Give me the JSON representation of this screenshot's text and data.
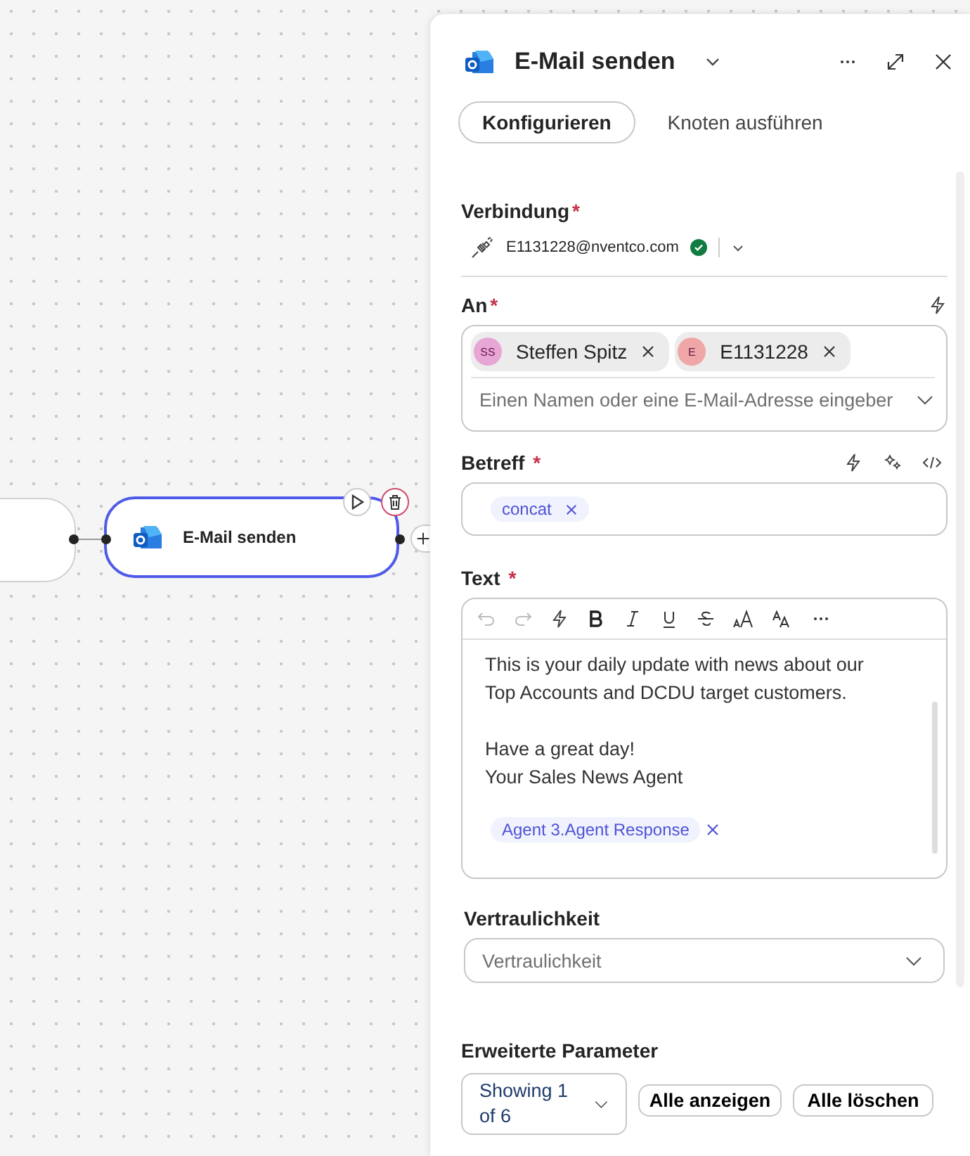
{
  "canvas": {
    "nodes": [
      {
        "kind": "partial"
      },
      {
        "kind": "action",
        "label": "E-Mail senden",
        "selected": true
      }
    ]
  },
  "panel": {
    "title": "E-Mail senden",
    "tabs": [
      {
        "label": "Konfigurieren",
        "selected": true
      },
      {
        "label": "Knoten ausführen",
        "selected": false
      }
    ],
    "connection": {
      "label": "Verbindung",
      "required_mark": "*",
      "account": "E1131228@nventco.com",
      "connected": true
    },
    "to": {
      "label": "An",
      "required_mark": "*",
      "recipients": [
        {
          "initials": "SS",
          "name": "Steffen Spitz",
          "color": "#e8a6d4"
        },
        {
          "initials": "E",
          "name": "E1131228",
          "color": "#f0a6a6"
        }
      ],
      "placeholder": "Einen Namen oder eine E-Mail-Adresse eingeber"
    },
    "subject": {
      "label": "Betreff",
      "required_mark": "*",
      "tokens": [
        "concat"
      ]
    },
    "body": {
      "label": "Text",
      "required_mark": "*",
      "paragraphs": [
        [
          "This is your daily update with news about our",
          "Top Accounts and DCDU target customers."
        ],
        [
          "Have a great day!",
          "Your Sales News Agent"
        ]
      ],
      "tokens": [
        "Agent 3.Agent Response"
      ]
    },
    "confidentiality": {
      "label": "Vertraulichkeit",
      "placeholder": "Vertraulichkeit"
    },
    "advanced": {
      "label": "Erweiterte Parameter",
      "showing": "Showing 1 of 6",
      "buttons": [
        "Alle anzeigen",
        "Alle löschen"
      ]
    }
  }
}
